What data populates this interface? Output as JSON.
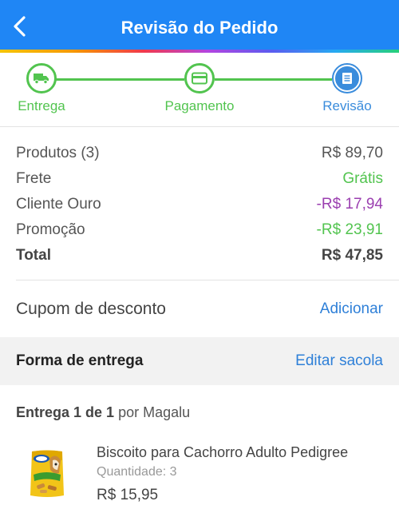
{
  "header": {
    "title": "Revisão do Pedido"
  },
  "stepper": {
    "steps": [
      {
        "label": "Entrega",
        "icon": "truck-icon",
        "state": "done"
      },
      {
        "label": "Pagamento",
        "icon": "card-icon",
        "state": "done"
      },
      {
        "label": "Revisão",
        "icon": "document-icon",
        "state": "current"
      }
    ]
  },
  "summary": {
    "produtos_label": "Produtos (3)",
    "produtos_value": "R$ 89,70",
    "frete_label": "Frete",
    "frete_value": "Grátis",
    "ouro_label": "Cliente Ouro",
    "ouro_value": "-R$ 17,94",
    "promo_label": "Promoção",
    "promo_value": "-R$ 23,91",
    "total_label": "Total",
    "total_value": "R$ 47,85"
  },
  "cupom": {
    "label": "Cupom de desconto",
    "action": "Adicionar"
  },
  "entrega_section": {
    "label": "Forma de entrega",
    "action": "Editar sacola"
  },
  "delivery": {
    "title": "Entrega 1 de 1",
    "by": "por Magalu"
  },
  "product": {
    "name": "Biscoito para Cachorro Adulto Pedigree",
    "quantity": "Quantidade: 3",
    "price": "R$ 15,95"
  },
  "colors": {
    "header": "#1f86f5",
    "green": "#52c44f",
    "purple": "#9b3fb0",
    "link": "#2f80d8",
    "step_current": "#3a8cdc"
  }
}
